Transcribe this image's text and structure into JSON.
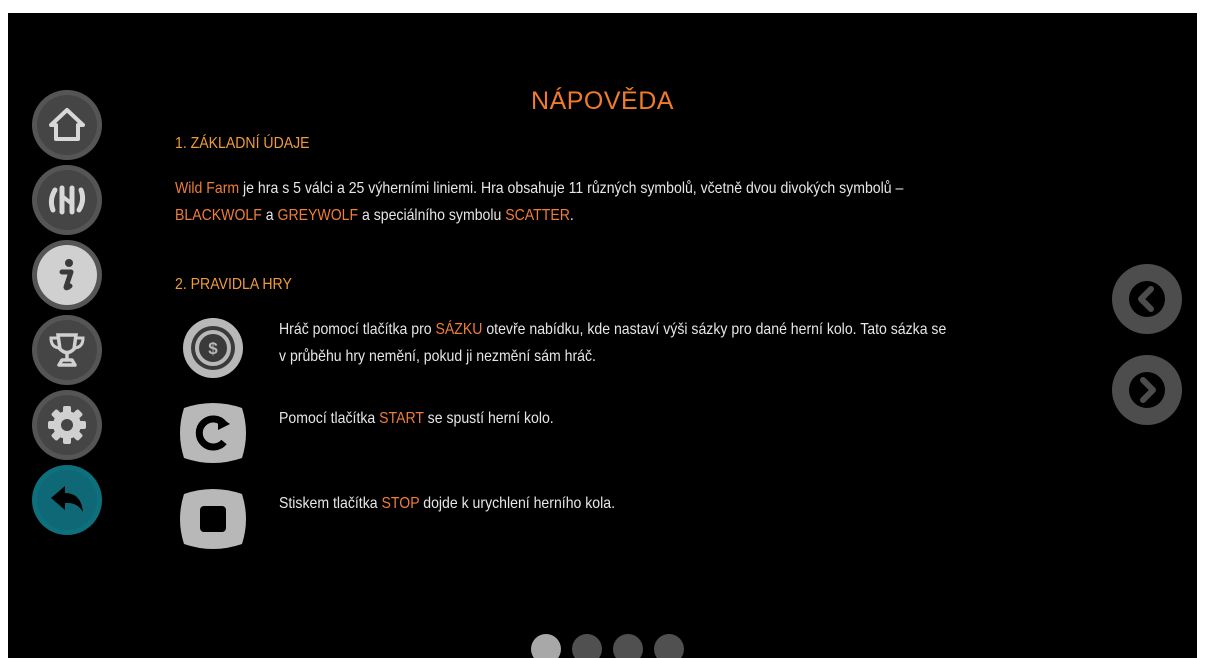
{
  "help": {
    "title": "NÁPOVĚDA",
    "section1": {
      "heading": "1. ZÁKLADNÍ ÚDAJE",
      "game_name": "Wild Farm",
      "text_a": " je hra s 5 válci a 25 výherními liniemi. Hra obsahuje 11 různých symbolů, včetně dvou divokých symbolů –",
      "wild1": "BLACKWOLF",
      "text_b": " a ",
      "wild2": "GREYWOLF",
      "text_c": " a speciálního symbolu ",
      "scatter": "SCATTER",
      "text_d": "."
    },
    "section2": {
      "heading": "2. PRAVIDLA HRY",
      "rule_bet": {
        "pre": "Hráč pomocí tlačítka pro ",
        "hl": "SÁZKU",
        "post": " otevře nabídku, kde nastaví výši sázky pro dané herní kolo. Tato sázka se",
        "line2": "v průběhu hry nemění, pokud ji nezmění sám hráč."
      },
      "rule_start": {
        "pre": "Pomocí tlačítka ",
        "hl": "START",
        "post": " se spustí herní kolo."
      },
      "rule_stop": {
        "pre": "Stiskem tlačítka ",
        "hl": "STOP",
        "post": " dojde k urychlení herního kola."
      }
    }
  },
  "sidebar": {
    "icons": [
      "home-icon",
      "paytable-icon",
      "info-icon",
      "trophy-icon",
      "settings-icon",
      "back-icon"
    ],
    "active": "back-icon"
  },
  "pagination": {
    "pages": 4,
    "current": 1
  },
  "colors": {
    "accent": "#f07b2a",
    "active_nav": "#0e6f7d",
    "background": "#000000"
  }
}
